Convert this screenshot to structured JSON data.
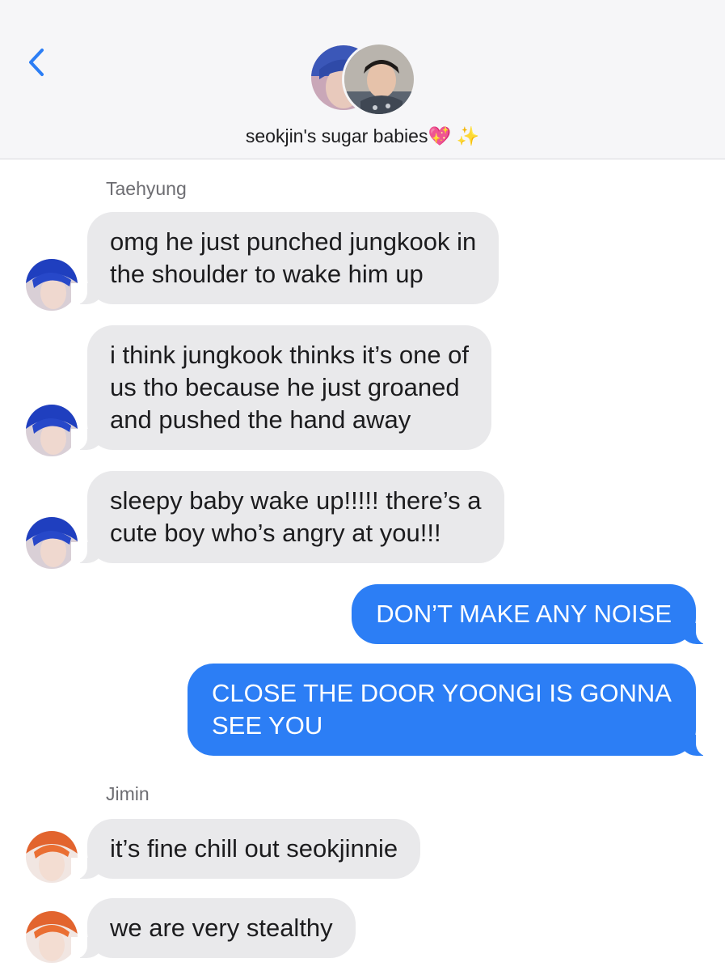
{
  "header": {
    "group_name": "seokjin's sugar babies",
    "title_emojis": [
      "💖",
      "✨"
    ]
  },
  "colors": {
    "accent_blue": "#2c7ef5",
    "incoming_bubble": "#e9e9eb",
    "header_bg": "#f6f6f8"
  },
  "icons": {
    "back": "chevron-left-icon"
  },
  "messages": [
    {
      "sender": "Taehyung",
      "direction": "incoming",
      "lines": [
        "omg he just punched jungkook in",
        "the shoulder to wake him up"
      ]
    },
    {
      "sender": "Taehyung",
      "direction": "incoming",
      "lines": [
        "i think jungkook thinks it’s one of",
        "us tho because he just groaned",
        "and pushed the hand away"
      ]
    },
    {
      "sender": "Taehyung",
      "direction": "incoming",
      "lines": [
        "sleepy baby wake up!!!!! there’s a",
        "cute boy who’s angry at you!!!"
      ]
    },
    {
      "sender": "me",
      "direction": "outgoing",
      "lines": [
        "DON’T MAKE ANY NOISE"
      ]
    },
    {
      "sender": "me",
      "direction": "outgoing",
      "lines": [
        "CLOSE THE DOOR YOONGI IS GONNA",
        "SEE YOU"
      ]
    },
    {
      "sender": "Jimin",
      "direction": "incoming",
      "lines": [
        "it’s fine chill out seokjinnie"
      ]
    },
    {
      "sender": "Jimin",
      "direction": "incoming",
      "lines": [
        "we are very stealthy"
      ]
    }
  ]
}
